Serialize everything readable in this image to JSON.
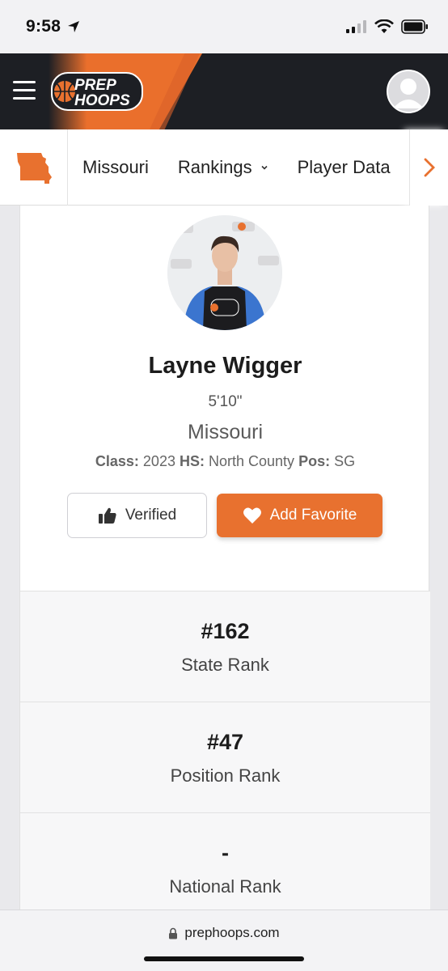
{
  "status_bar": {
    "time": "9:58"
  },
  "nav": {
    "logo_line1": "PREP",
    "logo_line2": "HOOPS"
  },
  "subnav": {
    "items": [
      {
        "label": "Missouri"
      },
      {
        "label": "Rankings"
      },
      {
        "label": "Player Data"
      }
    ]
  },
  "player": {
    "name": "Layne Wigger",
    "height": "5'10\"",
    "state": "Missouri",
    "class_label": "Class:",
    "class_value": "2023",
    "hs_label": "HS:",
    "hs_value": "North County",
    "pos_label": "Pos:",
    "pos_value": "SG"
  },
  "buttons": {
    "verified": "Verified",
    "favorite": "Add Favorite"
  },
  "ranks": [
    {
      "value": "#162",
      "label": "State Rank"
    },
    {
      "value": "#47",
      "label": "Position Rank"
    },
    {
      "value": "-",
      "label": "National Rank"
    }
  ],
  "browser": {
    "url": "prephoops.com"
  },
  "colors": {
    "accent": "#e8712f",
    "nav_bg": "#1d1f24"
  }
}
